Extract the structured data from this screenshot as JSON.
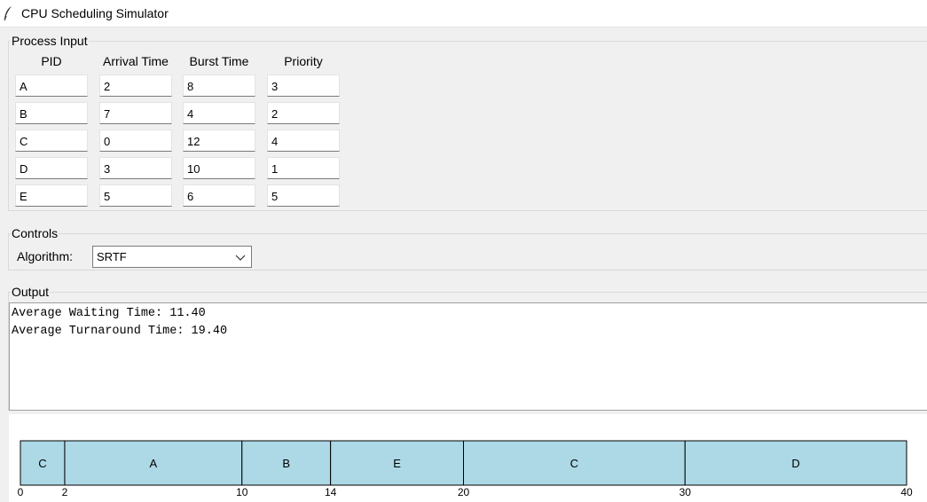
{
  "window": {
    "title": "CPU Scheduling Simulator",
    "icon": "feather-icon"
  },
  "process_input": {
    "legend": "Process Input",
    "columns": [
      "PID",
      "Arrival Time",
      "Burst Time",
      "Priority"
    ],
    "rows": [
      [
        "A",
        "2",
        "8",
        "3"
      ],
      [
        "B",
        "7",
        "4",
        "2"
      ],
      [
        "C",
        "0",
        "12",
        "4"
      ],
      [
        "D",
        "3",
        "10",
        "1"
      ],
      [
        "E",
        "5",
        "6",
        "5"
      ]
    ]
  },
  "controls": {
    "legend": "Controls",
    "algorithm_label": "Algorithm:",
    "algorithm_value": "SRTF"
  },
  "output": {
    "legend": "Output",
    "lines": [
      "Average Waiting Time: 11.40",
      "Average Turnaround Time: 19.40"
    ]
  },
  "chart_data": {
    "type": "gantt",
    "segments": [
      {
        "label": "C",
        "start": 0,
        "end": 2
      },
      {
        "label": "A",
        "start": 2,
        "end": 10
      },
      {
        "label": "B",
        "start": 10,
        "end": 14
      },
      {
        "label": "E",
        "start": 14,
        "end": 20
      },
      {
        "label": "C",
        "start": 20,
        "end": 30
      },
      {
        "label": "D",
        "start": 30,
        "end": 40
      }
    ],
    "ticks": [
      0,
      2,
      10,
      14,
      20,
      30,
      40
    ],
    "xlim": [
      0,
      40
    ],
    "bar_color": "#add8e6"
  }
}
